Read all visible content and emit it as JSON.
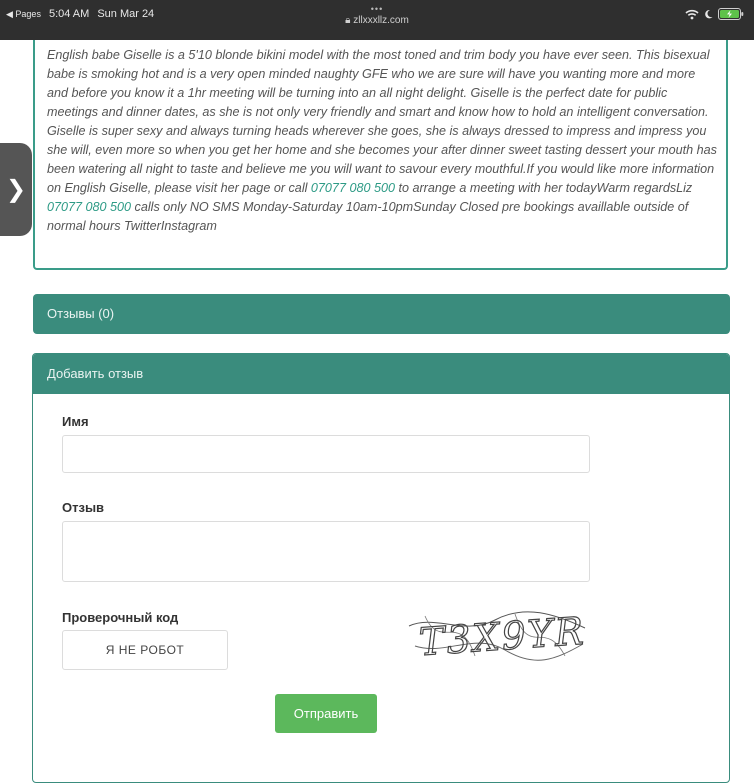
{
  "status_bar": {
    "back_label": "◀ Pages",
    "time": "5:04 AM",
    "date": "Sun Mar 24",
    "url": "zllxxxllz.com",
    "icons": [
      "wifi-icon",
      "moon-icon",
      "battery-charging-icon"
    ]
  },
  "side_tab": {
    "glyph": "❯",
    "icon": "chevron-right-icon"
  },
  "description": {
    "part1": "English babe Giselle is a 5'10 blonde bikini model with the most toned and trim body you have ever seen. This bisexual babe is smoking hot and is a very open minded naughty GFE who we are sure will have you wanting more and more and before you know it a 1hr meeting will be turning into an all night delight. Giselle is the perfect date for public meetings and dinner dates, as she is not only very friendly and smart and know how to hold an intelligent conversation. Giselle is super sexy and always turning heads wherever she goes, she is always dressed to impress and impress you she will, even more so when you get her home and she becomes your after dinner sweet tasting dessert your mouth has been watering all night to taste and believe me you will want to savour every mouthful.If you would like more information on English Giselle, please visit her page or call ",
    "phone1": "07077 080 500",
    "part2": " to arrange a meeting with her todayWarm regardsLiz ",
    "phone2": "07077 080 500",
    "part3": " calls only NO SMS Monday-Saturday 10am-10pmSunday Closed pre bookings availlable outside of normal hours TwitterInstagram"
  },
  "reviews": {
    "label": "Отзывы (0)"
  },
  "add_review": {
    "header": "Добавить отзыв",
    "name_label": "Имя",
    "name_value": "",
    "review_label": "Отзыв",
    "review_value": "",
    "captcha_label": "Проверочный код",
    "robot_button": "Я НЕ РОБОТ",
    "captcha_text": "T3X9YR",
    "submit_label": "Отправить"
  },
  "colors": {
    "teal": "#3a8c7d",
    "link": "#2e9b86",
    "submit": "#5cb85c",
    "status_bar": "#2f2f2f"
  }
}
